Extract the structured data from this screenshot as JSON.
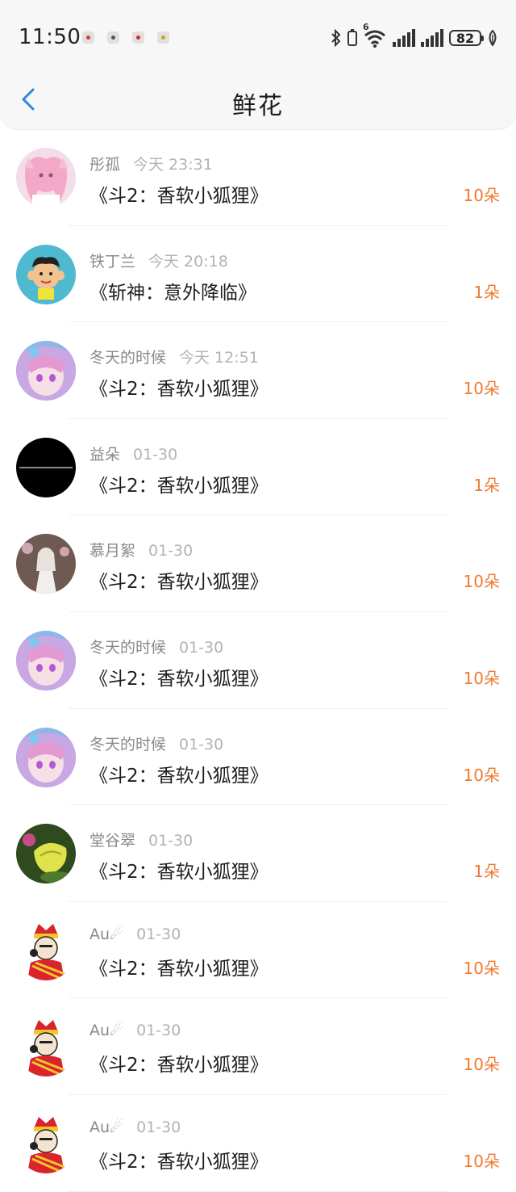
{
  "status_bar": {
    "time": "11:50",
    "battery": "82",
    "network_label": "6",
    "notification_icons": [
      "app-notification-icon",
      "app-notification-icon",
      "app-notification-icon",
      "app-notification-icon"
    ]
  },
  "header": {
    "title": "鲜花",
    "back_icon": "chevron-left-icon"
  },
  "colors": {
    "accent_orange": "#f07a30",
    "back_blue": "#2e86de"
  },
  "records": [
    {
      "name": "彤孤",
      "date": "今天 23:31",
      "book": "《斗2：香软小狐狸》",
      "count": "10朵"
    },
    {
      "name": "铁丁兰",
      "date": "今天 20:18",
      "book": "《斩神：意外降临》",
      "count": "1朵"
    },
    {
      "name": "冬天的时候",
      "date": "今天 12:51",
      "book": "《斗2：香软小狐狸》",
      "count": "10朵"
    },
    {
      "name": "益朵",
      "date": "01-30",
      "book": "《斗2：香软小狐狸》",
      "count": "1朵"
    },
    {
      "name": "慕月絮",
      "date": "01-30",
      "book": "《斗2：香软小狐狸》",
      "count": "10朵"
    },
    {
      "name": "冬天的时候",
      "date": "01-30",
      "book": "《斗2：香软小狐狸》",
      "count": "10朵"
    },
    {
      "name": "冬天的时候",
      "date": "01-30",
      "book": "《斗2：香软小狐狸》",
      "count": "10朵"
    },
    {
      "name": "堂谷翠",
      "date": "01-30",
      "book": "《斗2：香软小狐狸》",
      "count": "1朵"
    },
    {
      "name": "Au☄",
      "date": "01-30",
      "book": "《斗2：香软小狐狸》",
      "count": "10朵"
    },
    {
      "name": "Au☄",
      "date": "01-30",
      "book": "《斗2：香软小狐狸》",
      "count": "10朵"
    },
    {
      "name": "Au☄",
      "date": "01-30",
      "book": "《斗2：香软小狐狸》",
      "count": "10朵"
    }
  ]
}
